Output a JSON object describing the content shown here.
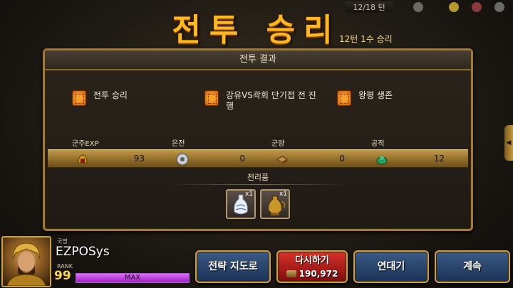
{
  "hud": {
    "turn_counter": "12/18 턴"
  },
  "header": {
    "title": "전투 승리",
    "subtitle": "12턴 1수 승리"
  },
  "result_panel": {
    "title": "전투 결과",
    "conditions": [
      {
        "label": "전투 승리",
        "icon": "seal-icon"
      },
      {
        "label": "강유VS곽회 단기접 전 진행",
        "icon": "seal-icon"
      },
      {
        "label": "왕평 생존",
        "icon": "seal-icon"
      }
    ],
    "stats": [
      {
        "label": "군주EXP",
        "value": "93",
        "icon": "helmet-icon"
      },
      {
        "label": "은전",
        "value": "0",
        "icon": "coin-icon"
      },
      {
        "label": "군량",
        "value": "0",
        "icon": "provisions-icon"
      },
      {
        "label": "공적",
        "value": "12",
        "icon": "jade-icon"
      }
    ],
    "spoils_title": "전리품",
    "spoils": [
      {
        "name": "porcelain-vase",
        "count": "x1"
      },
      {
        "name": "golden-ewer",
        "count": "x1"
      }
    ]
  },
  "player": {
    "nation_label": "국명",
    "name": "EZPOSys",
    "rank_label": "RANK",
    "rank": "99",
    "xp_text": "MAX",
    "xp_fraction": 1.0
  },
  "buttons": {
    "strategy_map": "전략 지도로",
    "retry": "다시하기",
    "retry_cost": "190,972",
    "chain": "연대기",
    "continue": "계속"
  },
  "colors": {
    "title": "#ffb81e",
    "panel_border": "#a07a36",
    "button_blue": "#2a4670",
    "button_red": "#b01e18",
    "xp_fill": "#c040e0"
  }
}
